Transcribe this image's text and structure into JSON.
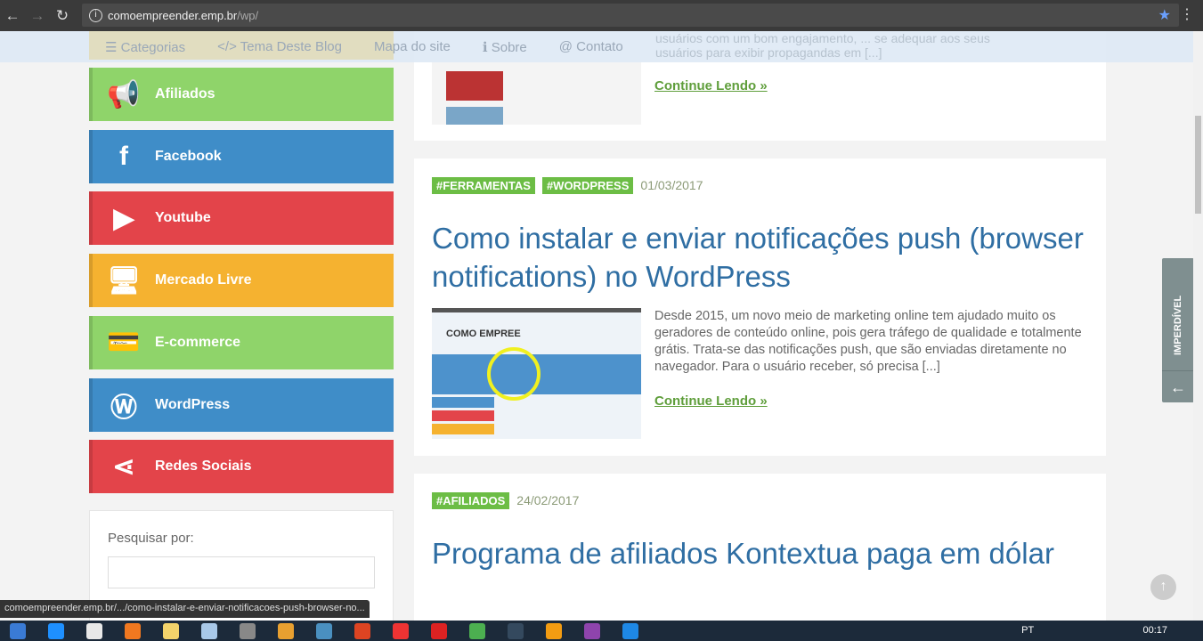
{
  "browser": {
    "url_host": "comoempreender.emp.br",
    "url_path": "/wp/",
    "status_url": "comoempreender.emp.br/.../como-instalar-e-enviar-notificacoes-push-browser-no..."
  },
  "topnav": [
    "☰ Categorias",
    "</> Tema Deste Blog",
    "Mapa do site",
    "ℹ Sobre",
    "@ Contato"
  ],
  "ghost_text": [
    "usuários com um bom engajamento, ... se adequar aos seus",
    "usuários para exibir propagandas em [...]"
  ],
  "sidebar": [
    {
      "label": "Afiliados",
      "icon": "megaphone-icon",
      "glyph": "📢",
      "color": "g"
    },
    {
      "label": "Facebook",
      "icon": "facebook-icon",
      "glyph": "f",
      "color": "b"
    },
    {
      "label": "Youtube",
      "icon": "youtube-icon",
      "glyph": "▶",
      "color": "r"
    },
    {
      "label": "Mercado Livre",
      "icon": "monitor-icon",
      "glyph": "🖥",
      "color": "o"
    },
    {
      "label": "E-commerce",
      "icon": "credit-card-icon",
      "glyph": "💳",
      "color": "g"
    },
    {
      "label": "WordPress",
      "icon": "wordpress-icon",
      "glyph": "Ⓦ",
      "color": "b"
    },
    {
      "label": "Redes Sociais",
      "icon": "share-icon",
      "glyph": "⋖",
      "color": "r"
    }
  ],
  "search": {
    "label": "Pesquisar por:"
  },
  "posts": [
    {
      "continue": "Continue Lendo »"
    },
    {
      "tags": [
        "#FERRAMENTAS",
        "#WORDPRESS"
      ],
      "date": "01/03/2017",
      "title": "Como instalar e enviar notificações push (browser notifications) no WordPress",
      "excerpt": "Desde 2015, um novo meio de marketing online tem ajudado muito os geradores de conteúdo online, pois gera tráfego de qualidade e totalmente grátis. Trata-se das notificações push, que são enviadas diretamente no navegador. Para o usuário receber, só precisa [...]",
      "continue": "Continue Lendo »",
      "thumb_text": "COMO EMPREE"
    },
    {
      "tags": [
        "#AFILIADOS"
      ],
      "date": "24/02/2017",
      "title": "Programa de afiliados Kontextua paga em dólar"
    }
  ],
  "imperdivel": "IMPERDÍVEL",
  "tray": {
    "lang": "PT",
    "time": "00:17"
  }
}
